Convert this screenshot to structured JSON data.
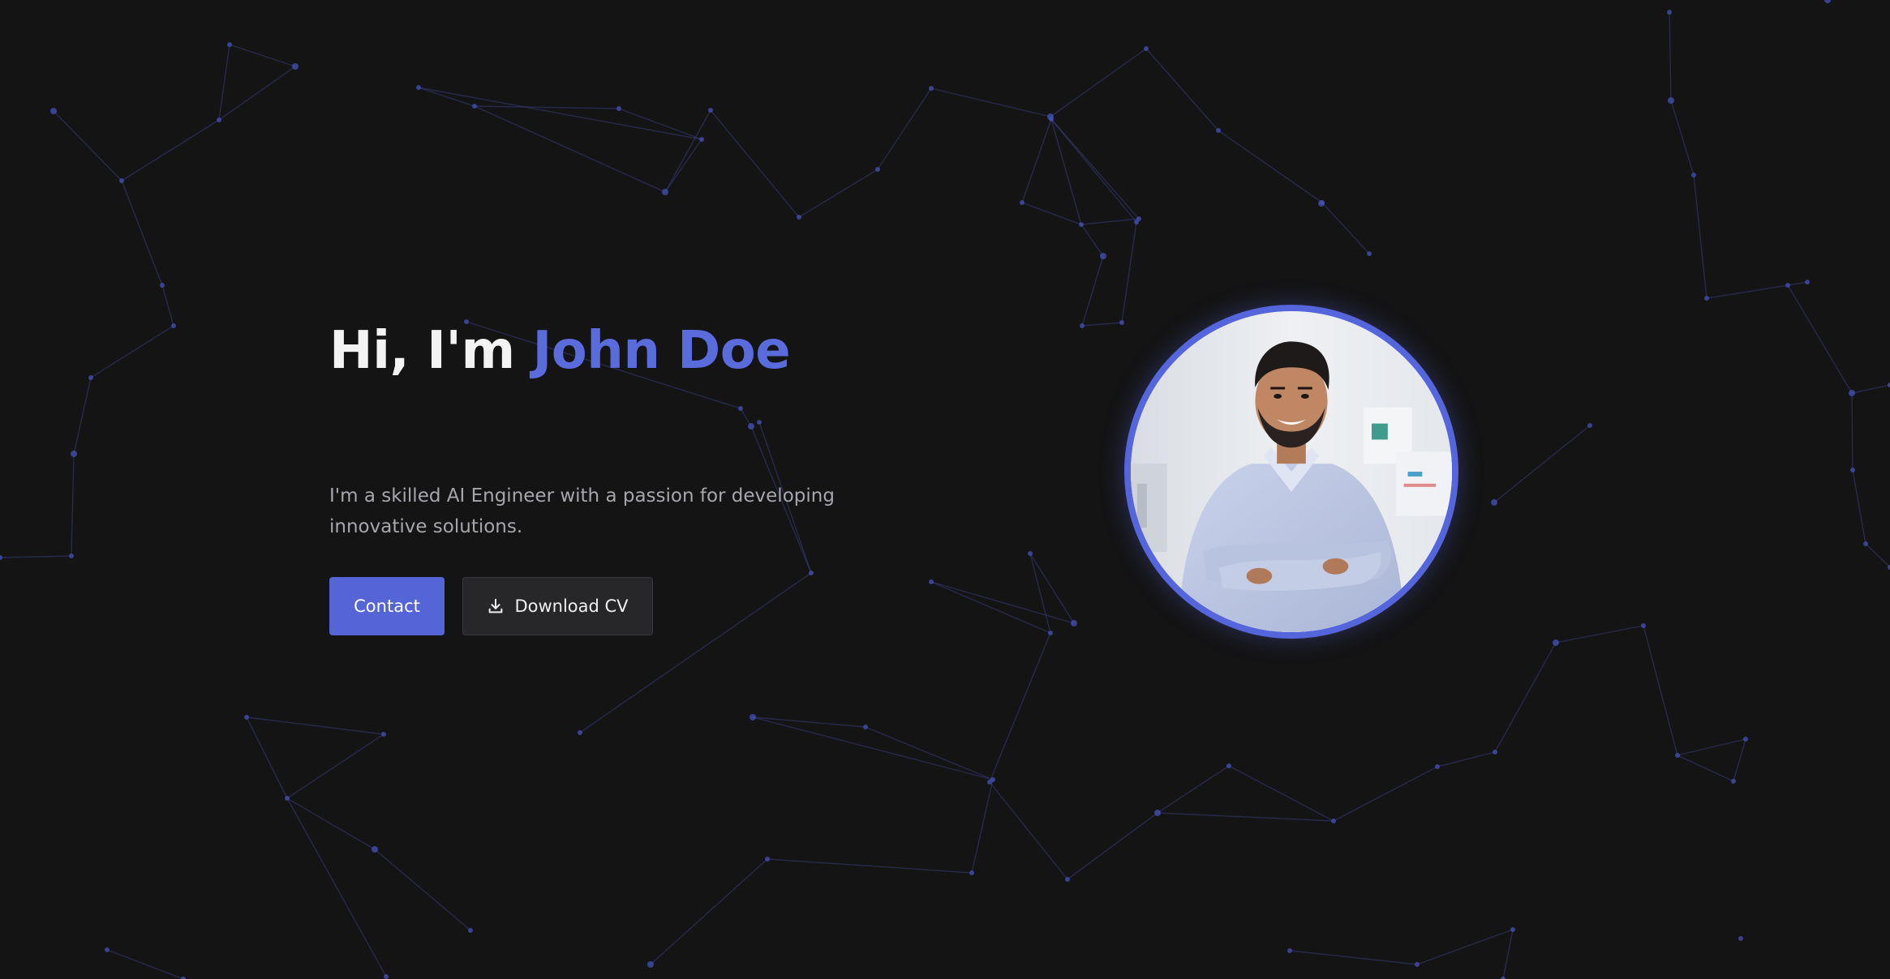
{
  "hero": {
    "greeting": "Hi, I'm ",
    "name": "John Doe",
    "description": "I'm a skilled AI Engineer with a passion for developing innovative solutions."
  },
  "buttons": {
    "contact_label": "Contact",
    "download_cv_label": "Download CV",
    "download_icon": "download-icon"
  },
  "avatar": {
    "alt": "Portrait of John Doe"
  },
  "colors": {
    "background": "#141415",
    "accent": "#5565d8",
    "name_accent": "#5a6bdc",
    "heading": "#f3f3f4",
    "body_text": "#a6a6ad",
    "secondary_button": "#27272a",
    "network_lines": "#3d448f"
  }
}
